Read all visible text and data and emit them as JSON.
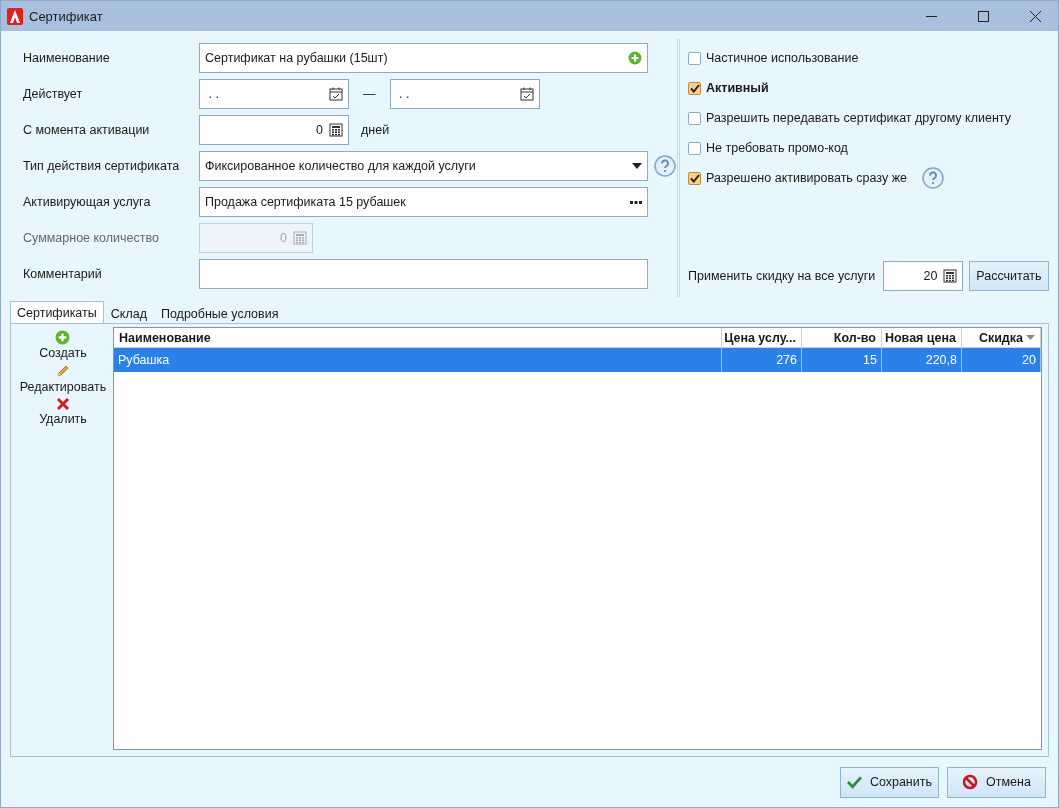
{
  "window": {
    "title": "Сертификат"
  },
  "form": [
    {
      "kind": "text",
      "label": "Наименование",
      "value": "Сертификат на рубашки (15шт)",
      "add_button": true
    },
    {
      "kind": "daterange",
      "label": "Действует",
      "from": ". .",
      "to": ". .",
      "separator": "—"
    },
    {
      "kind": "number",
      "label": "С момента активации",
      "value": "0",
      "suffix": "дней",
      "disabled": false
    },
    {
      "kind": "select",
      "label": "Тип действия сертификата",
      "value": "Фиксированное количество для каждой услуги"
    },
    {
      "kind": "lookup",
      "label": "Активирующая услуга",
      "value": "Продажа сертификата 15 рубашек"
    },
    {
      "kind": "number",
      "label": "Суммарное количество",
      "value": "0",
      "disabled": true
    },
    {
      "kind": "text",
      "label": "Комментарий",
      "add_button": false
    }
  ],
  "options": [
    {
      "kind": "plain",
      "label": "Частичное использование",
      "checked": false,
      "bold": false
    },
    {
      "kind": "plain",
      "label": "Активный",
      "checked": true,
      "bold": true
    },
    {
      "kind": "plain",
      "label": "Разрешить передавать сертификат другому клиенту",
      "checked": false,
      "bold": false
    },
    {
      "kind": "plain",
      "label": "Не требовать промо-код",
      "checked": false,
      "bold": false
    },
    {
      "kind": "with_help",
      "label": "Разрешено активировать сразу же",
      "checked": true,
      "bold": false
    }
  ],
  "discount": {
    "label": "Применить скидку на все услуги",
    "value": "20",
    "button": "Рассчитать"
  },
  "tabs": [
    {
      "label": "Сертификаты",
      "selected": true
    },
    {
      "label": "Склад",
      "selected": false
    },
    {
      "label": "Подробные условия",
      "selected": false
    }
  ],
  "toolbar": [
    {
      "kind": "add",
      "label": "Создать"
    },
    {
      "kind": "edit",
      "label": "Редактировать"
    },
    {
      "kind": "delete",
      "label": "Удалить"
    }
  ],
  "table": {
    "columns": [
      {
        "label": "Наименование",
        "sorted": false
      },
      {
        "label": "Цена услу...",
        "sorted": false
      },
      {
        "label": "Кол-во",
        "sorted": false
      },
      {
        "label": "Новая цена",
        "sorted": false
      },
      {
        "label": "Скидка",
        "sorted": true
      }
    ],
    "rows": [
      {
        "cells": [
          "Рубашка",
          "276",
          "15",
          "220,8",
          "20"
        ],
        "selected": true
      }
    ]
  },
  "buttons": [
    {
      "kind": "save",
      "label": "Сохранить"
    },
    {
      "kind": "cancel",
      "label": "Отмена"
    }
  ]
}
